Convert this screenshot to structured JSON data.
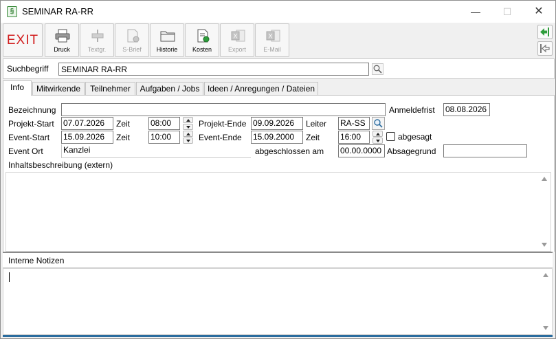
{
  "window": {
    "title": "SEMINAR RA-RR",
    "app_icon_char": "§"
  },
  "toolbar": {
    "exit_label": "EXIT",
    "buttons": [
      {
        "label": "Druck",
        "enabled": true
      },
      {
        "label": "Textgr.",
        "enabled": false
      },
      {
        "label": "S-Brief",
        "enabled": false
      },
      {
        "label": "Historie",
        "enabled": true
      },
      {
        "label": "Kosten",
        "enabled": true
      },
      {
        "label": "Export",
        "enabled": false
      },
      {
        "label": "E-Mail",
        "enabled": false
      }
    ]
  },
  "search": {
    "label": "Suchbegriff",
    "value": "SEMINAR RA-RR"
  },
  "tabs": [
    {
      "label": "Info",
      "active": true
    },
    {
      "label": "Mitwirkende",
      "active": false
    },
    {
      "label": "Teilnehmer",
      "active": false
    },
    {
      "label": "Aufgaben / Jobs",
      "active": false
    },
    {
      "label": "Ideen / Anregungen / Dateien",
      "active": false
    }
  ],
  "form": {
    "bezeichnung_label": "Bezeichnung",
    "bezeichnung_value": "",
    "anmeldefrist_label": "Anmeldefrist",
    "anmeldefrist_value": "08.08.2026",
    "projekt_start_label": "Projekt-Start",
    "projekt_start_value": "07.07.2026",
    "zeit_label": "Zeit",
    "projekt_start_zeit": "08:00",
    "projekt_ende_label": "Projekt-Ende",
    "projekt_ende_value": "09.09.2026",
    "leiter_label": "Leiter",
    "leiter_value": "RA-SS",
    "event_start_label": "Event-Start",
    "event_start_value": "15.09.2026",
    "event_start_zeit": "10:00",
    "event_ende_label": "Event-Ende",
    "event_ende_value": "15.09.2000",
    "event_ende_zeit": "16:00",
    "abgesagt_label": "abgesagt",
    "event_ort_label": "Event Ort",
    "event_ort_value": "Kanzlei",
    "abgeschlossen_label": "abgeschlossen am",
    "abgeschlossen_value": "00.00.0000",
    "absagegrund_label": "Absagegrund",
    "absagegrund_value": "",
    "inhalt_label": "Inhaltsbeschreibung (extern)"
  },
  "notes": {
    "label": "Interne Notizen"
  },
  "colors": {
    "exit_red": "#d21f1f",
    "accent_blue": "#2b6c9e",
    "nav_green": "#2e9d3b"
  }
}
